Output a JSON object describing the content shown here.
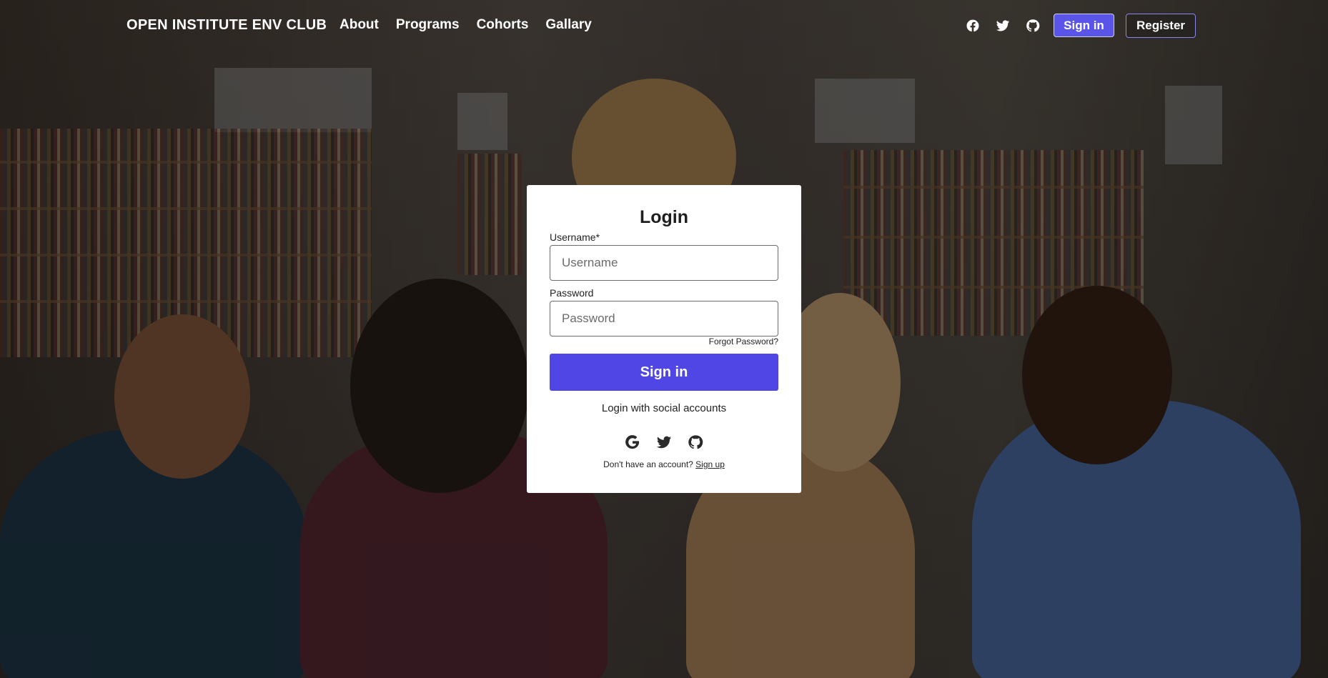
{
  "nav": {
    "brand": "OPEN INSTITUTE ENV CLUB",
    "links": [
      "About",
      "Programs",
      "Cohorts",
      "Gallary"
    ],
    "icons": [
      "facebook-icon",
      "twitter-icon",
      "github-icon"
    ],
    "signin_label": "Sign in",
    "register_label": "Register"
  },
  "login": {
    "title": "Login",
    "username_label": "Username*",
    "username_placeholder": "Username",
    "password_label": "Password",
    "password_placeholder": "Password",
    "forgot_label": "Forgot Password?",
    "submit_label": "Sign in",
    "social_text": "Login with social accounts",
    "social_icons": [
      "google-icon",
      "twitter-icon",
      "github-icon"
    ],
    "no_account_text": "Don't have an account?",
    "signup_label": "Sign up"
  },
  "colors": {
    "primary": "#4f46e5",
    "nav_signin_bg": "#5a54e8",
    "card_bg": "#ffffff"
  }
}
